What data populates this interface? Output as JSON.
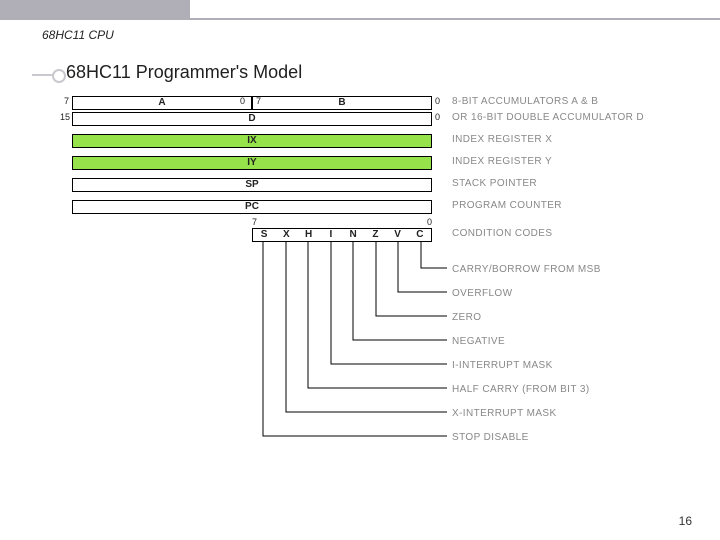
{
  "breadcrumb": "68HC11 CPU",
  "title": "68HC11 Programmer's Model",
  "page_number": "16",
  "row_ab": {
    "a_left": "7",
    "a_name": "A",
    "a_right": "0",
    "b_left": "7",
    "b_name": "B",
    "b_right": "0",
    "desc": "8-BIT ACCUMULATORS A & B"
  },
  "row_d": {
    "left": "15",
    "name": "D",
    "right": "0",
    "desc": "OR 16-BIT DOUBLE ACCUMULATOR D"
  },
  "row_ix": {
    "name": "IX",
    "desc": "INDEX REGISTER X"
  },
  "row_iy": {
    "name": "IY",
    "desc": "INDEX REGISTER Y"
  },
  "row_sp": {
    "name": "SP",
    "desc": "STACK POINTER"
  },
  "row_pc": {
    "name": "PC",
    "desc": "PROGRAM COUNTER"
  },
  "ccr": {
    "left_num": "7",
    "right_num": "0",
    "bits": [
      "S",
      "X",
      "H",
      "I",
      "N",
      "Z",
      "V",
      "C"
    ],
    "desc": "CONDITION CODES",
    "flag_desc": [
      "CARRY/BORROW FROM MSB",
      "OVERFLOW",
      "ZERO",
      "NEGATIVE",
      "I-INTERRUPT MASK",
      "HALF CARRY (FROM BIT 3)",
      "X-INTERRUPT MASK",
      "STOP DISABLE"
    ]
  }
}
